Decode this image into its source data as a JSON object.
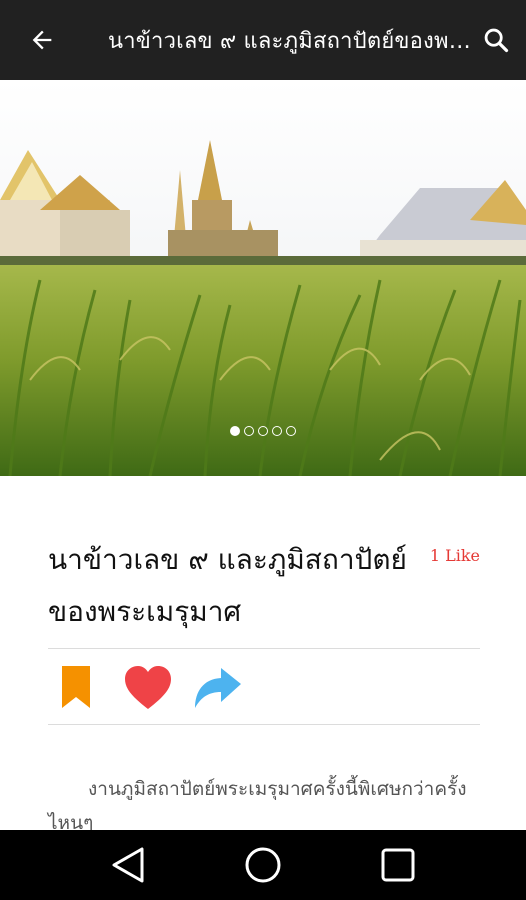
{
  "appbar": {
    "title": "นาข้าวเลข ๙ และภูมิสถาปัตย์ของพระเมรุมาศ",
    "back_icon": "arrow-left-icon",
    "search_icon": "search-icon"
  },
  "gallery": {
    "current_index": 1,
    "total": 5,
    "description_icon": "rice-field-photo"
  },
  "article": {
    "headline": "นาข้าวเลข ๙ และภูมิสถาปัตย์ของพระเมรุมาศ",
    "likes": "1 Like",
    "body_preview": "งานภูมิสถาปัตย์พระเมรุมาศครั้งนี้พิเศษกว่าครั้งไหนๆ"
  },
  "actions": {
    "bookmark_icon": "bookmark-icon",
    "heart_icon": "heart-icon",
    "share_icon": "share-icon",
    "bookmark_color": "#f59100",
    "heart_color": "#ef4347",
    "share_color": "#4db3ef"
  },
  "navbar": {
    "back_icon": "triangle-back-icon",
    "home_icon": "circle-home-icon",
    "recents_icon": "square-recents-icon"
  }
}
